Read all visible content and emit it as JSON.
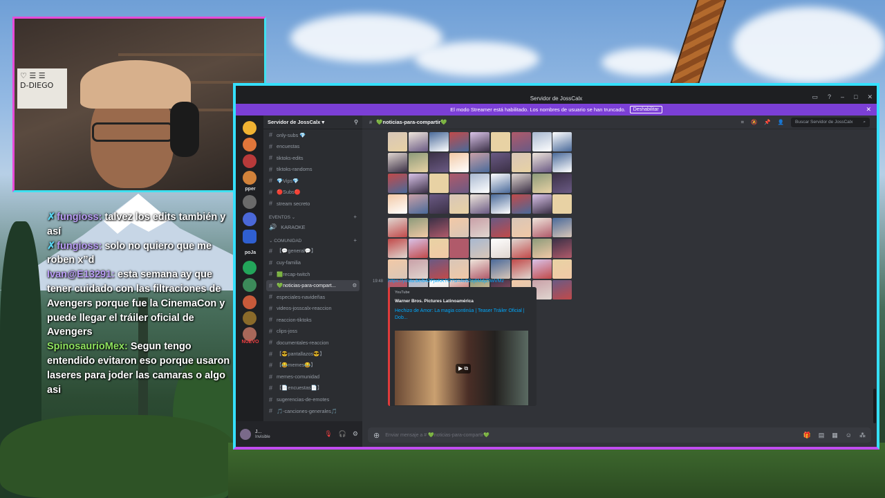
{
  "webcam": {
    "sign_text": "D-DIEGO"
  },
  "chat": [
    {
      "user": "fungioss:",
      "text": " talvez los edits también y así",
      "pin": true
    },
    {
      "user": "fungioss:",
      "text": " solo no quiero que me roben x”d",
      "pin": true
    },
    {
      "user": "Ivan@E13291:",
      "text": " esta semana ay que tener cuidado con las filtraciones de Avengers porque fue la CinemaCon y puede llegar el tráiler oficial de Avengers",
      "pin": false
    },
    {
      "user": "SpinosaurioMex:",
      "text": " Segun tengo entendido evitaron eso porque usaron laseres para joder las camaras o algo asi",
      "pin": false
    }
  ],
  "discord": {
    "window_title": "Servidor de JossCalx",
    "banner": {
      "text": "El modo Streamer está habilitado. Los nombres de usuario se han truncado.",
      "button": "Deshabilitar"
    },
    "server_name": "Servidor de JossCalx",
    "guild_labels": [
      "pper",
      "poJa",
      "NUEVO"
    ],
    "channels_top": [
      {
        "name": "only-subs 💎"
      },
      {
        "name": "encuestas"
      },
      {
        "name": "tiktoks-edits"
      },
      {
        "name": "tiktoks-randoms"
      },
      {
        "name": "💎Vips💎"
      },
      {
        "name": "🔴Subs🔴"
      },
      {
        "name": "stream secreto"
      }
    ],
    "category_eventos": "EVENTOS",
    "channel_karaoke": "KARAOKE",
    "category_comunidad": "Comunidad",
    "channels_community": [
      {
        "name": "【💬general💬】",
        "active": false
      },
      {
        "name": "cuy-familia",
        "active": false
      },
      {
        "name": "🟩recap-twitch",
        "active": false
      },
      {
        "name": "💚noticias-para-compart...",
        "active": true
      },
      {
        "name": "especiales-navideñas",
        "active": false
      },
      {
        "name": "videos-josscalx-reaccion",
        "active": false
      },
      {
        "name": "reaccion-tiktoks",
        "active": false
      },
      {
        "name": "clips-joss",
        "active": false
      },
      {
        "name": "documentales-reaccion",
        "active": false
      },
      {
        "name": "【😎pantallazos😎】",
        "active": false
      },
      {
        "name": "【😂memes😂】",
        "active": false
      },
      {
        "name": "memes-comunidad",
        "active": false
      },
      {
        "name": "【📄encuestas📄】",
        "active": false
      },
      {
        "name": "sugerencias-de-emotes",
        "active": false
      },
      {
        "name": "🎵-canciones-generales🎵",
        "active": false
      }
    ],
    "user": {
      "name": "J...",
      "status": "Invisible"
    },
    "channel_header": "💚noticias-para-compartir💚",
    "search_placeholder": "Buscar Servidor de JossCalx",
    "message_time": "19:48",
    "message_link": "https://youtu.be/b42FjwKKTO?si=Avb2oj6MdjZhwVMz",
    "embed": {
      "provider": "YouTube",
      "author": "Warner Bros. Pictures Latinoamérica",
      "title": "Hechizo de Amor: La magia continúa | Teaser Tráiler Oficial | Dob..."
    },
    "composer_placeholder": "Enviar mensaje a # 💚noticias-para-compartir💚",
    "tile_colors": [
      "#d8c6b8",
      "#c9a0a7",
      "#3b3046",
      "#e0d6d0",
      "#a8b8d0",
      "#e8d2a4",
      "#c14a4a",
      "#efe6dc",
      "#6a5a84",
      "#f2c9a6",
      "#8c9a7a",
      "#ffffff",
      "#b05a6a",
      "#d9c3e8",
      "#4a6a9a"
    ]
  }
}
